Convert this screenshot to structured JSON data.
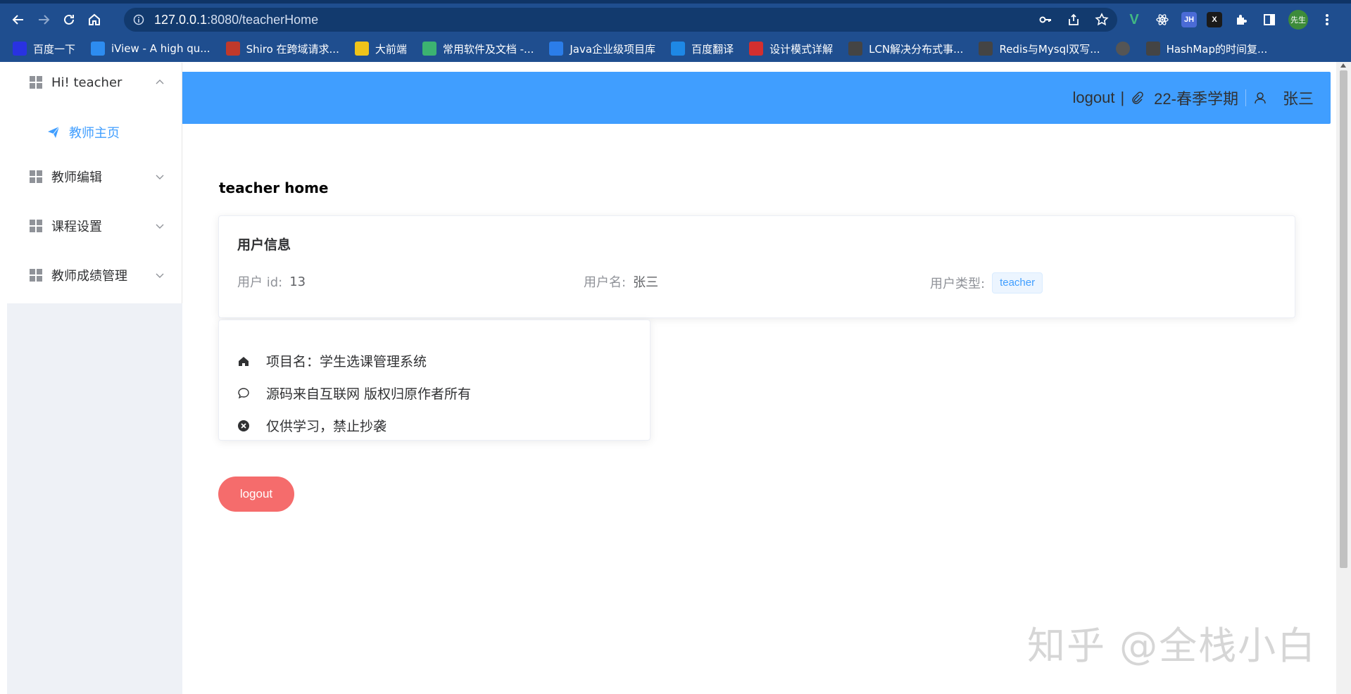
{
  "browser": {
    "url_host": "127.0.0.1",
    "url_path": ":8080/teacherHome",
    "profile_label": "先生",
    "extensions": [
      "V",
      "JH",
      "X"
    ],
    "bookmarks": [
      {
        "label": "百度一下",
        "color": "#2932e1",
        "icon": "baidu-paw-icon"
      },
      {
        "label": "iView - A high qu...",
        "color": "#2d8cf0",
        "icon": "iview-icon"
      },
      {
        "label": "Shiro 在跨域请求...",
        "color": "#c0392b",
        "icon": "cube-icon"
      },
      {
        "label": "大前端",
        "color": "#f0c419",
        "icon": "book-icon"
      },
      {
        "label": "常用软件及文档 -...",
        "color": "#3cb371",
        "icon": "leaf-icon"
      },
      {
        "label": "Java企业级项目库",
        "color": "#2b7de9",
        "icon": "edge-icon"
      },
      {
        "label": "百度翻译",
        "color": "#1e88e5",
        "icon": "translate-icon"
      },
      {
        "label": "设计模式详解",
        "color": "#d32f2f",
        "icon": "c-logo-icon"
      },
      {
        "label": "LCN解决分布式事...",
        "color": "#444444",
        "icon": "github-icon"
      },
      {
        "label": "Redis与Mysql双写...",
        "color": "#444444",
        "icon": "github-icon"
      },
      {
        "label": "",
        "color": "#555555",
        "icon": "globe-icon"
      },
      {
        "label": "HashMap的时间复...",
        "color": "#444444",
        "icon": "github-icon"
      }
    ]
  },
  "header": {
    "logout": "logout",
    "separator": "|",
    "semester": "22-春季学期",
    "username": "张三"
  },
  "sidebar": {
    "groups": [
      {
        "label": "Hi! teacher",
        "expanded": true
      },
      {
        "label": "教师编辑",
        "expanded": false
      },
      {
        "label": "课程设置",
        "expanded": false
      },
      {
        "label": "教师成绩管理",
        "expanded": false
      }
    ],
    "active_sub_item": "教师主页"
  },
  "main": {
    "title": "teacher home",
    "user_card": {
      "title": "用户信息",
      "id_label": "用户 id:",
      "id_value": "13",
      "name_label": "用户名:",
      "name_value": "张三",
      "type_label": "用户类型:",
      "type_value": "teacher"
    },
    "info_card": {
      "rows": [
        {
          "icon": "home-icon",
          "text": "项目名：学生选课管理系统"
        },
        {
          "icon": "chat-bubble-icon",
          "text": "源码来自互联网 版权归原作者所有"
        },
        {
          "icon": "close-circle-icon",
          "text": "仅供学习，禁止抄袭"
        }
      ]
    },
    "logout_button": "logout"
  },
  "watermark": "知乎 @全栈小白",
  "colors": {
    "primary": "#409eff",
    "danger": "#f56c6c",
    "chrome": "#1f4e8f"
  }
}
